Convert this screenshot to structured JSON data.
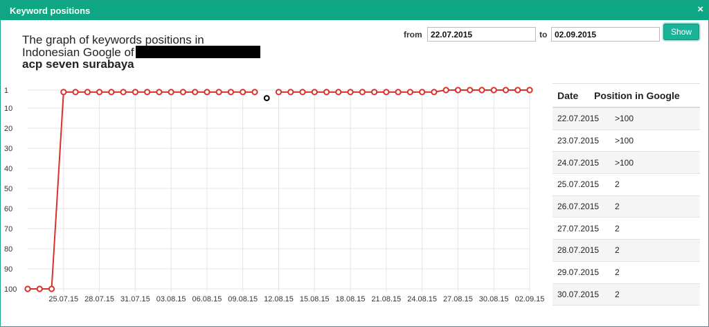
{
  "modal": {
    "title": "Keyword positions",
    "close_glyph": "×"
  },
  "heading": {
    "line1": "The graph of keywords positions in",
    "line2": "Indonesian Google of",
    "keyword": "acp seven surabaya"
  },
  "filter": {
    "from_label": "from",
    "from_value": "22.07.2015",
    "to_label": "to",
    "to_value": "02.09.2015",
    "show_label": "Show"
  },
  "colors": {
    "accent": "#0fa684",
    "line": "#d9302c",
    "missing_point": "#000000"
  },
  "chart_data": {
    "type": "line",
    "y_reversed": true,
    "ylim": [
      1,
      100
    ],
    "y_ticks": [
      "1",
      "10",
      "20",
      "30",
      "40",
      "50",
      "60",
      "70",
      "80",
      "90",
      "100"
    ],
    "x_ticks": [
      "25.07.15",
      "28.07.15",
      "31.07.15",
      "03.08.15",
      "06.08.15",
      "09.08.15",
      "12.08.15",
      "15.08.15",
      "18.08.15",
      "21.08.15",
      "24.08.15",
      "27.08.15",
      "30.08.15",
      "02.09.15"
    ],
    "x_dates": [
      "22.07",
      "23.07",
      "24.07",
      "25.07",
      "26.07",
      "27.07",
      "28.07",
      "29.07",
      "30.07",
      "31.07",
      "01.08",
      "02.08",
      "03.08",
      "04.08",
      "05.08",
      "06.08",
      "07.08",
      "08.08",
      "09.08",
      "10.08",
      "11.08",
      "12.08",
      "13.08",
      "14.08",
      "15.08",
      "16.08",
      "17.08",
      "18.08",
      "19.08",
      "20.08",
      "21.08",
      "22.08",
      "23.08",
      "24.08",
      "25.08",
      "26.08",
      "27.08",
      "28.08",
      "29.08",
      "30.08",
      "31.08",
      "01.09",
      "02.09"
    ],
    "positions": [
      100,
      100,
      100,
      2,
      2,
      2,
      2,
      2,
      2,
      2,
      2,
      2,
      2,
      2,
      2,
      2,
      2,
      2,
      2,
      2,
      null,
      2,
      2,
      2,
      2,
      2,
      2,
      2,
      2,
      2,
      2,
      2,
      2,
      2,
      2,
      1,
      1,
      1,
      1,
      1,
      1,
      1,
      1
    ],
    "missing_marker_index": 20,
    "missing_marker_value": 5
  },
  "table": {
    "headers": [
      "Date",
      "Position in Google"
    ],
    "rows": [
      [
        "22.07.2015",
        ">100"
      ],
      [
        "23.07.2015",
        ">100"
      ],
      [
        "24.07.2015",
        ">100"
      ],
      [
        "25.07.2015",
        "2"
      ],
      [
        "26.07.2015",
        "2"
      ],
      [
        "27.07.2015",
        "2"
      ],
      [
        "28.07.2015",
        "2"
      ],
      [
        "29.07.2015",
        "2"
      ],
      [
        "30.07.2015",
        "2"
      ]
    ]
  }
}
